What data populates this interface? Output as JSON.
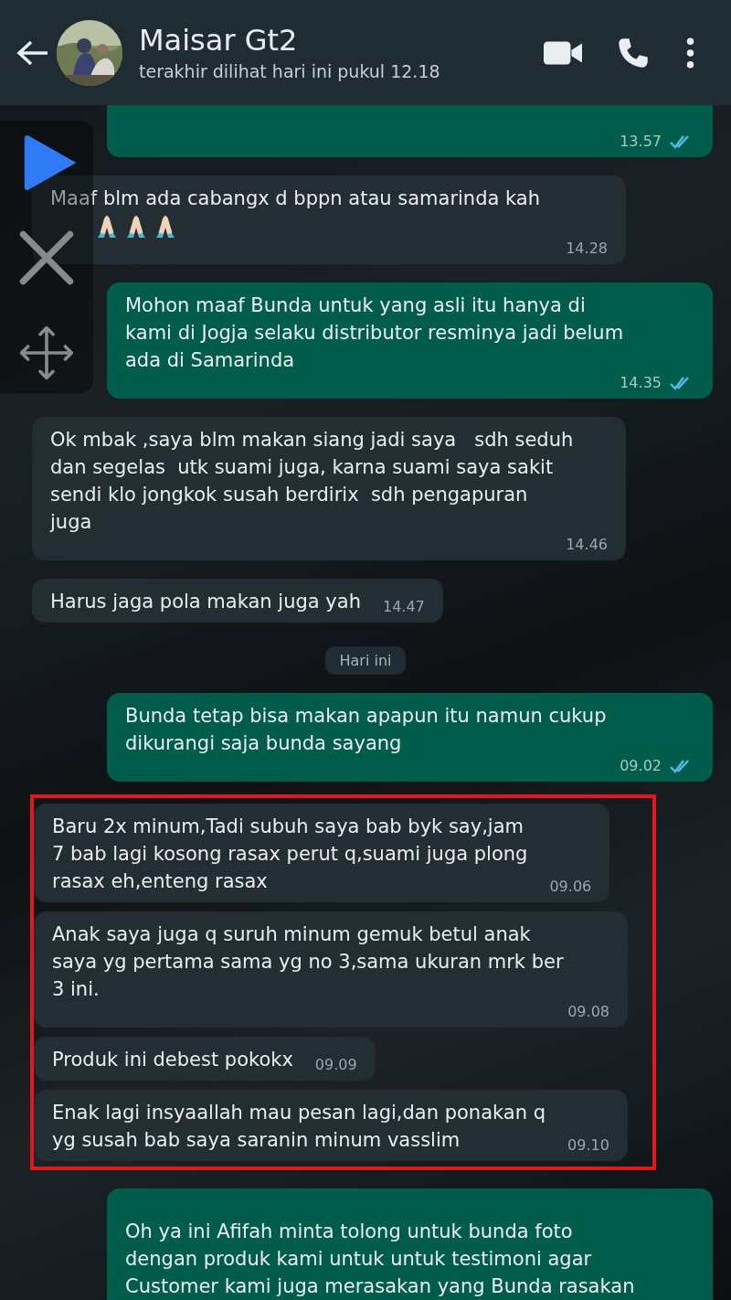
{
  "header": {
    "contact_name": "Maisar Gt2",
    "last_seen": "terakhir dilihat hari ini pukul 12.18"
  },
  "messages": [
    {
      "kind": "outgoing",
      "time": "13.57",
      "read": true,
      "cut_top": true
    },
    {
      "kind": "incoming",
      "text": "Maaf blm ada cabangx d bppn atau samarinda kah",
      "time": "14.28",
      "prayer_icons": true
    },
    {
      "kind": "outgoing",
      "text": "Mohon maaf Bunda untuk yang asli itu hanya di\nkami di Jogja selaku distributor resminya jadi belum\nada di Samarinda",
      "time": "14.35",
      "read": true
    },
    {
      "kind": "incoming",
      "text": "Ok mbak ,saya blm makan siang jadi saya   sdh seduh\ndan segelas  utk suami juga, karna suami saya sakit\nsendi klo jongkok susah berdirix  sdh pengapuran\njuga",
      "time": "14.46"
    },
    {
      "kind": "incoming",
      "text": "Harus jaga pola makan juga yah",
      "time": "14.47"
    },
    {
      "kind": "date",
      "text": "Hari ini"
    },
    {
      "kind": "outgoing",
      "text": "Bunda tetap bisa makan apapun itu namun cukup\ndikurangi saja bunda sayang",
      "time": "09.02",
      "read": true
    }
  ],
  "highlighted_messages": [
    {
      "kind": "incoming",
      "text": "Baru 2x minum,Tadi subuh saya bab byk say,jam\n7 bab lagi kosong rasax perut q,suami juga plong\nrasax eh,enteng rasax",
      "time": "09.06"
    },
    {
      "kind": "incoming",
      "text": "Anak saya juga q suruh minum gemuk betul anak\nsaya yg pertama sama yg no 3,sama ukuran mrk ber\n3 ini.",
      "time": "09.08"
    },
    {
      "kind": "incoming",
      "text": "Produk ini debest pokokx",
      "time": "09.09"
    },
    {
      "kind": "incoming",
      "text": "Enak lagi insyaallah mau pesan lagi,dan ponakan q\nyg susah bab saya saranin minum vasslim",
      "time": "09.10"
    }
  ],
  "after_messages": [
    {
      "kind": "outgoing",
      "text": "Oh ya ini Afifah minta tolong untuk bunda foto\ndengan produk kami untuk untuk testimoni agar\nCustomer kami juga merasakan yang Bunda rasakan",
      "cut_bottom": true
    }
  ]
}
